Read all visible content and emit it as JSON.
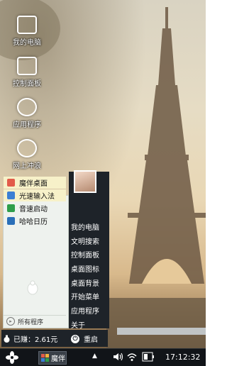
{
  "desktop": {
    "icons": [
      {
        "name": "my-computer",
        "label": "我的电脑"
      },
      {
        "name": "control-panel",
        "label": "控制面板"
      },
      {
        "name": "applications",
        "label": "应用程序"
      },
      {
        "name": "internet",
        "label": "网上冲浪"
      }
    ]
  },
  "start_menu": {
    "pinned": [
      {
        "label": "魔伴桌面",
        "icon": "pinwheel-icon",
        "color": "#e25b4a"
      },
      {
        "label": "光速输入法",
        "icon": "g-input-icon",
        "color": "#3b7fd4"
      },
      {
        "label": "音速启动",
        "icon": "v-launch-icon",
        "color": "#2e9e4b"
      },
      {
        "label": "哈哈日历",
        "icon": "calendar-icon",
        "color": "#2a6fb8"
      }
    ],
    "all_programs": "所有程序",
    "right_items": [
      "我的电脑",
      "文明搜索",
      "控制面板",
      "桌面图标",
      "桌面背景",
      "开始菜单",
      "应用程序",
      "关于"
    ],
    "earnings": "已赚：2.61元",
    "restart": "重启"
  },
  "taskbar": {
    "app_label": "魔伴",
    "clock": "17:12:32"
  }
}
